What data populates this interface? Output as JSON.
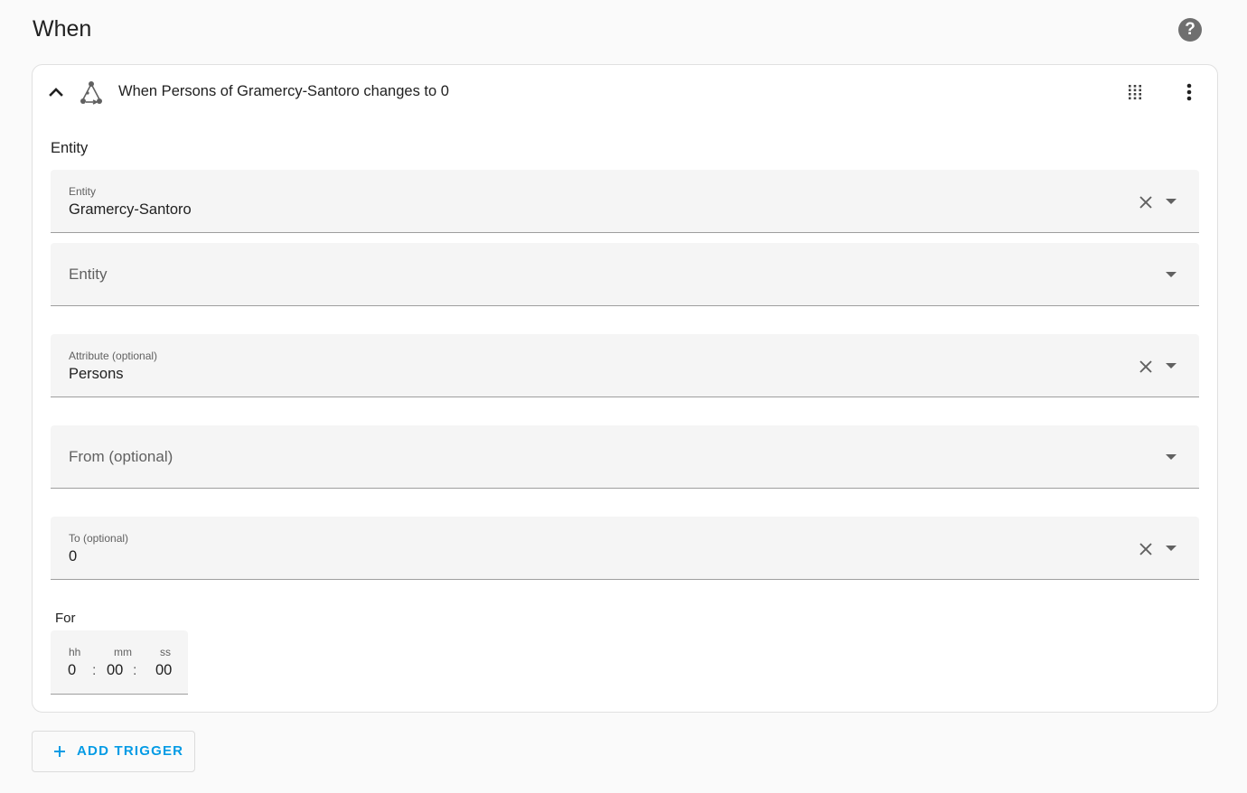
{
  "section": {
    "title": "When",
    "help_icon": "help-circle-icon",
    "help_glyph": "?"
  },
  "trigger": {
    "title": "When Persons of Gramercy-Santoro changes to 0",
    "icons": {
      "collapse": "chevron-up-icon",
      "type": "state-trigger-icon",
      "drag": "drag-handle-icon",
      "menu": "dots-vertical-icon"
    },
    "entity_heading": "Entity",
    "fields": [
      {
        "id": "entity-1",
        "label": "Entity",
        "value": "Gramercy-Santoro",
        "placeholder": "",
        "clearable": true
      },
      {
        "id": "entity-2",
        "label": "",
        "value": "",
        "placeholder": "Entity",
        "clearable": false
      },
      {
        "id": "attribute",
        "label": "Attribute (optional)",
        "value": "Persons",
        "placeholder": "",
        "clearable": true
      },
      {
        "id": "from",
        "label": "",
        "value": "",
        "placeholder": "From (optional)",
        "clearable": false
      },
      {
        "id": "to",
        "label": "To (optional)",
        "value": "0",
        "placeholder": "",
        "clearable": true
      }
    ],
    "for": {
      "label": "For",
      "units": {
        "hh": "hh",
        "mm": "mm",
        "ss": "ss"
      },
      "values": {
        "hh": "0",
        "mm": "00",
        "ss": "00"
      },
      "separator": ":"
    }
  },
  "add_trigger": {
    "label": "ADD TRIGGER",
    "icon": "plus-icon"
  },
  "colors": {
    "accent": "#039be5",
    "field_bg": "#f5f5f5",
    "icon": "#616161"
  }
}
